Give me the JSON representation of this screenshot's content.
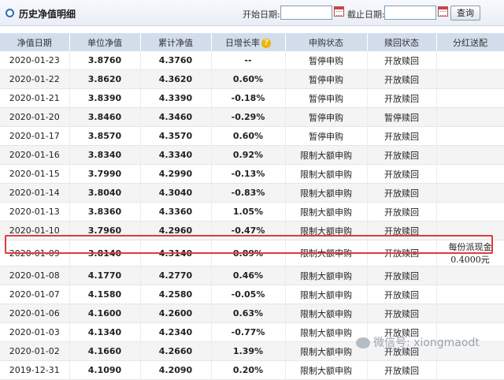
{
  "header": {
    "title": "历史净值明细",
    "start_label": "开始日期:",
    "end_label": "截止日期:",
    "start_value": "",
    "end_value": "",
    "query_label": "查询"
  },
  "table": {
    "columns": [
      "净值日期",
      "单位净值",
      "累计净值",
      "日增长率",
      "申购状态",
      "赎回状态",
      "分红送配"
    ],
    "rows": [
      {
        "date": "2020-01-23",
        "nav": "3.8760",
        "acc": "4.3760",
        "rate": "--",
        "sign": "neutral",
        "sub": "暂停申购",
        "red": "开放赎回",
        "div": ""
      },
      {
        "date": "2020-01-22",
        "nav": "3.8620",
        "acc": "4.3620",
        "rate": "0.60%",
        "sign": "pos",
        "sub": "暂停申购",
        "red": "开放赎回",
        "div": ""
      },
      {
        "date": "2020-01-21",
        "nav": "3.8390",
        "acc": "4.3390",
        "rate": "-0.18%",
        "sign": "neg",
        "sub": "暂停申购",
        "red": "开放赎回",
        "div": ""
      },
      {
        "date": "2020-01-20",
        "nav": "3.8460",
        "acc": "4.3460",
        "rate": "-0.29%",
        "sign": "neg",
        "sub": "暂停申购",
        "red": "暂停赎回",
        "div": ""
      },
      {
        "date": "2020-01-17",
        "nav": "3.8570",
        "acc": "4.3570",
        "rate": "0.60%",
        "sign": "pos",
        "sub": "暂停申购",
        "red": "开放赎回",
        "div": ""
      },
      {
        "date": "2020-01-16",
        "nav": "3.8340",
        "acc": "4.3340",
        "rate": "0.92%",
        "sign": "pos",
        "sub": "限制大额申购",
        "red": "开放赎回",
        "div": ""
      },
      {
        "date": "2020-01-15",
        "nav": "3.7990",
        "acc": "4.2990",
        "rate": "-0.13%",
        "sign": "neg",
        "sub": "限制大额申购",
        "red": "开放赎回",
        "div": ""
      },
      {
        "date": "2020-01-14",
        "nav": "3.8040",
        "acc": "4.3040",
        "rate": "-0.83%",
        "sign": "neg",
        "sub": "限制大额申购",
        "red": "开放赎回",
        "div": ""
      },
      {
        "date": "2020-01-13",
        "nav": "3.8360",
        "acc": "4.3360",
        "rate": "1.05%",
        "sign": "pos",
        "sub": "限制大额申购",
        "red": "开放赎回",
        "div": ""
      },
      {
        "date": "2020-01-10",
        "nav": "3.7960",
        "acc": "4.2960",
        "rate": "-0.47%",
        "sign": "neg",
        "sub": "限制大额申购",
        "red": "开放赎回",
        "div": ""
      },
      {
        "date": "2020-01-09",
        "nav": "3.8140",
        "acc": "4.3140",
        "rate": "0.89%",
        "sign": "pos",
        "sub": "限制大额申购",
        "red": "开放赎回",
        "div": "每份派现金0.4000元"
      },
      {
        "date": "2020-01-08",
        "nav": "4.1770",
        "acc": "4.2770",
        "rate": "0.46%",
        "sign": "pos",
        "sub": "限制大额申购",
        "red": "开放赎回",
        "div": ""
      },
      {
        "date": "2020-01-07",
        "nav": "4.1580",
        "acc": "4.2580",
        "rate": "-0.05%",
        "sign": "neg",
        "sub": "限制大额申购",
        "red": "开放赎回",
        "div": ""
      },
      {
        "date": "2020-01-06",
        "nav": "4.1600",
        "acc": "4.2600",
        "rate": "0.63%",
        "sign": "pos",
        "sub": "限制大额申购",
        "red": "开放赎回",
        "div": ""
      },
      {
        "date": "2020-01-03",
        "nav": "4.1340",
        "acc": "4.2340",
        "rate": "-0.77%",
        "sign": "neg",
        "sub": "限制大额申购",
        "red": "开放赎回",
        "div": ""
      },
      {
        "date": "2020-01-02",
        "nav": "4.1660",
        "acc": "4.2660",
        "rate": "1.39%",
        "sign": "pos",
        "sub": "限制大额申购",
        "red": "开放赎回",
        "div": ""
      },
      {
        "date": "2019-12-31",
        "nav": "4.1090",
        "acc": "4.2090",
        "rate": "0.20%",
        "sign": "pos",
        "sub": "限制大额申购",
        "red": "开放赎回",
        "div": ""
      }
    ]
  },
  "watermark": "微信号: xiongmaodt",
  "colors": {
    "positive": "#d11f1f",
    "negative": "#1c8a1c",
    "header_bg": "#d2ddec",
    "highlight": "#e03c3c"
  }
}
